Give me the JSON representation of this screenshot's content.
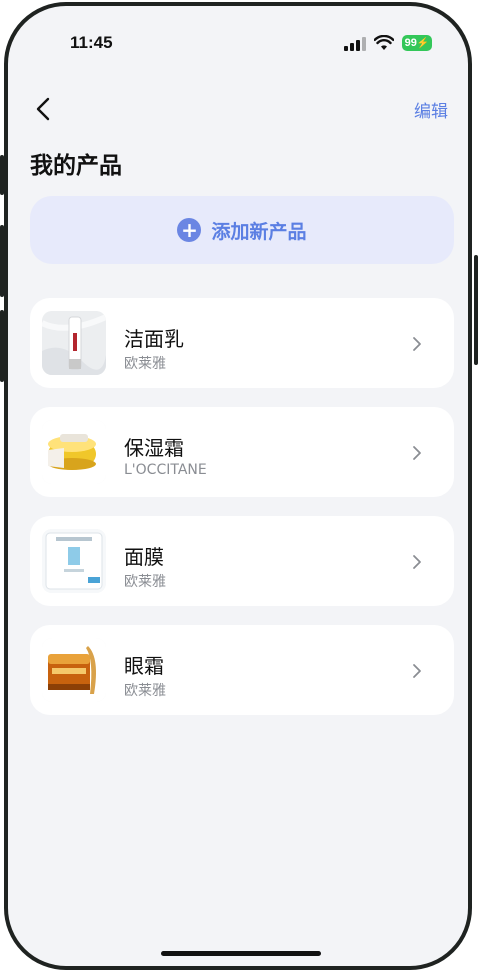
{
  "status_bar": {
    "time": "11:45",
    "battery": "99"
  },
  "nav": {
    "back_icon": "chevron-left-icon",
    "edit_label": "编辑"
  },
  "page": {
    "title": "我的产品"
  },
  "add_button": {
    "icon": "plus-circle-icon",
    "label": "添加新产品"
  },
  "products": [
    {
      "name": "洁面乳",
      "brand": "欧莱雅",
      "thumbnail": "cleanser-tube-thumbnail"
    },
    {
      "name": "保湿霜",
      "brand": "L'OCCITANE",
      "thumbnail": "cream-jar-thumbnail"
    },
    {
      "name": "面膜",
      "brand": "欧莱雅",
      "thumbnail": "mask-pack-thumbnail"
    },
    {
      "name": "眼霜",
      "brand": "欧莱雅",
      "thumbnail": "eye-cream-jar-thumbnail"
    }
  ],
  "colors": {
    "accent": "#5b7fe3",
    "add_button_bg": "#e7eafb",
    "page_bg": "#f3f4f7",
    "battery_green": "#33c759"
  }
}
